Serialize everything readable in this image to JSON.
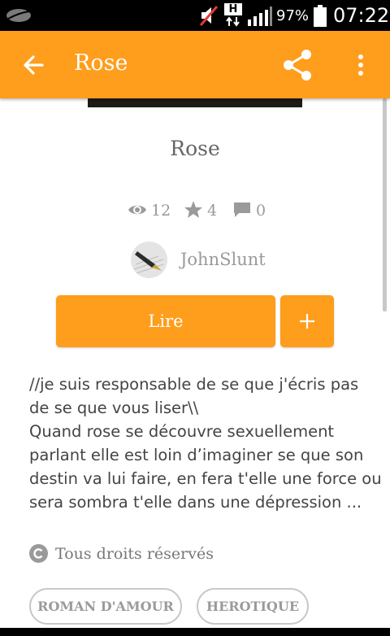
{
  "status_bar": {
    "battery_percent": "97%",
    "time": "07:22",
    "network_type": "H",
    "icons": [
      "leaf-icon",
      "mute-icon",
      "signal-icon",
      "battery-icon"
    ]
  },
  "toolbar": {
    "title": "Rose",
    "background_color": "#ff9d1c",
    "icons": [
      "back-arrow-icon",
      "share-icon",
      "more-vert-icon"
    ]
  },
  "story": {
    "title": "Rose",
    "views": "12",
    "votes": "4",
    "comments": "0",
    "author": "JohnSlunt",
    "read_label": "Lire",
    "add_label": "+",
    "description_lines": [
      "//je suis responsable de se que j'écris pas",
      "de se que vous liser\\\\",
      "Quand rose se découvre sexuellement",
      "parlant elle est loin d’imaginer se que son",
      "destin va lui faire, en fera t'elle une force ou",
      "sera sombra t'elle dans une dépression ..."
    ],
    "copyright": "Tous droits réservés",
    "tags": [
      "ROMAN D'AMOUR",
      "HEROTIQUE"
    ]
  }
}
